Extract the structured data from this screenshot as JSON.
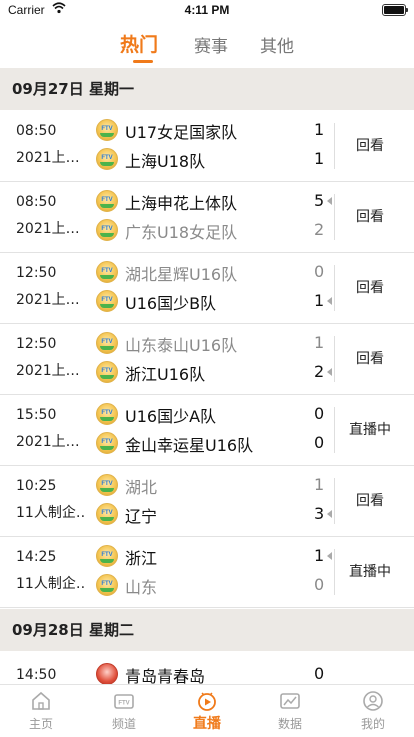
{
  "status_bar": {
    "carrier": "Carrier",
    "time": "4:11 PM"
  },
  "top_tabs": [
    {
      "label": "热门",
      "active": true
    },
    {
      "label": "赛事",
      "active": false
    },
    {
      "label": "其他",
      "active": false
    }
  ],
  "accent_color": "#f07a1a",
  "sections": [
    {
      "date": "09月27日 星期一"
    },
    {
      "date": "09月28日 星期二"
    }
  ],
  "matches": [
    {
      "time": "08:50",
      "desc": "2021上…",
      "home": "U17女足国家队",
      "home_score": "1",
      "away": "上海U18队",
      "away_score": "1",
      "status": "回看"
    },
    {
      "time": "08:50",
      "desc": "2021上…",
      "home": "上海申花上体队",
      "home_score": "5",
      "away": "广东U18女足队",
      "away_score": "2",
      "status": "回看"
    },
    {
      "time": "12:50",
      "desc": "2021上…",
      "home": "湖北星辉U16队",
      "home_score": "0",
      "away": "U16国少B队",
      "away_score": "1",
      "status": "回看"
    },
    {
      "time": "12:50",
      "desc": "2021上…",
      "home": "山东泰山U16队",
      "home_score": "1",
      "away": "浙江U16队",
      "away_score": "2",
      "status": "回看"
    },
    {
      "time": "15:50",
      "desc": "2021上…",
      "home": "U16国少A队",
      "home_score": "0",
      "away": "金山幸运星U16队",
      "away_score": "0",
      "status": "直播中"
    },
    {
      "time": "10:25",
      "desc": "11人制企…",
      "home": "湖北",
      "home_score": "1",
      "away": "辽宁",
      "away_score": "3",
      "status": "回看"
    },
    {
      "time": "14:25",
      "desc": "11人制企…",
      "home": "浙江",
      "home_score": "1",
      "away": "山东",
      "away_score": "0",
      "status": "直播中"
    }
  ],
  "partial_match": {
    "time": "14:50",
    "home": "青岛青春岛",
    "home_score": "0"
  },
  "logo_text": "FTV",
  "bottom_nav": [
    {
      "label": "主页",
      "icon": "home-icon"
    },
    {
      "label": "频道",
      "icon": "tv-icon"
    },
    {
      "label": "直播",
      "icon": "live-play-icon",
      "active": true
    },
    {
      "label": "数据",
      "icon": "data-chart-icon"
    },
    {
      "label": "我的",
      "icon": "profile-icon"
    }
  ]
}
